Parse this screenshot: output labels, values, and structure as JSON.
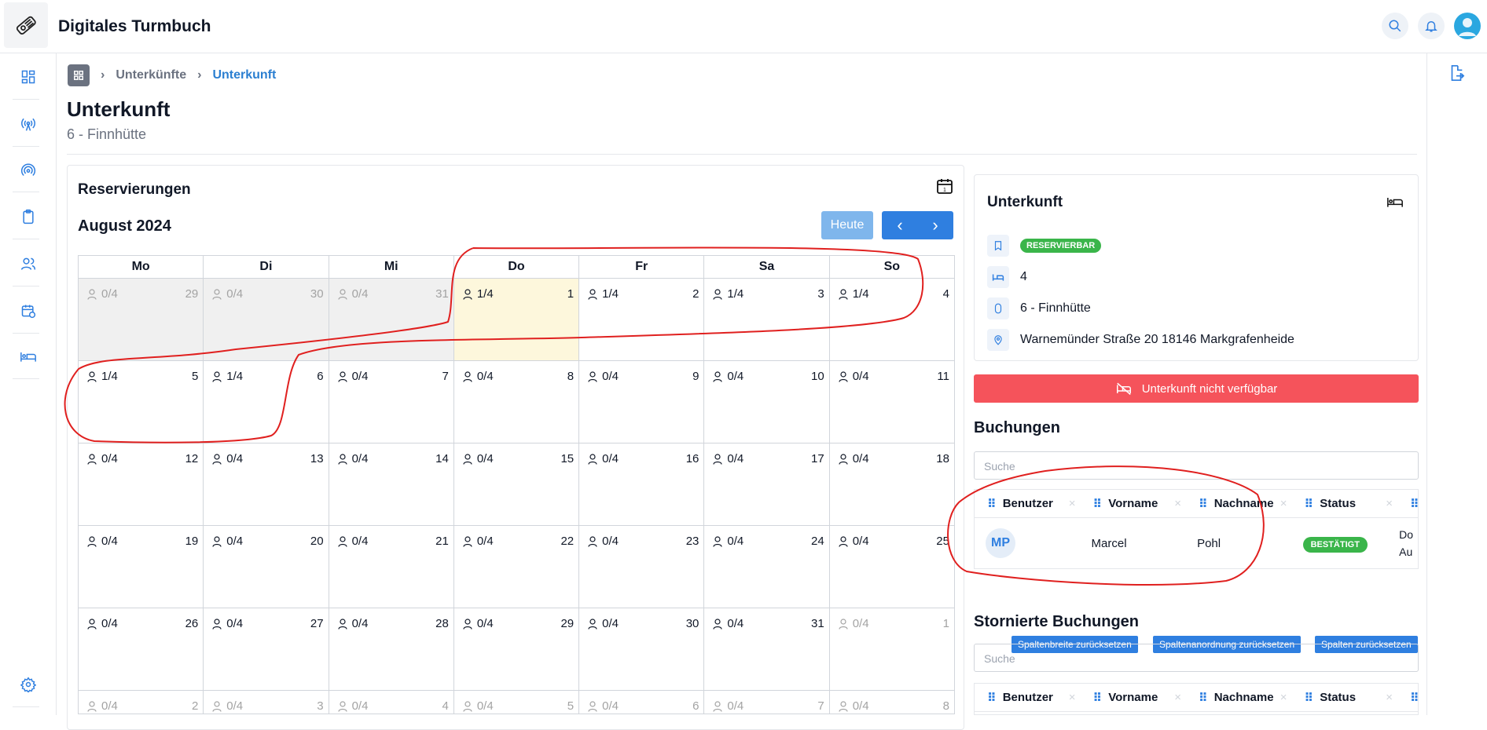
{
  "app": {
    "title": "Digitales Turmbuch"
  },
  "breadcrumb": {
    "items": [
      "Unterkünfte",
      "Unterkunft"
    ]
  },
  "page": {
    "title": "Unterkunft",
    "subtitle": "6 - Finnhütte"
  },
  "calendar": {
    "title": "Reservierungen",
    "month": "August 2024",
    "today_label": "Heute",
    "weekdays": [
      "Mo",
      "Di",
      "Mi",
      "Do",
      "Fr",
      "Sa",
      "So"
    ],
    "weeks": [
      [
        {
          "d": "29",
          "o": "0/4",
          "other": true
        },
        {
          "d": "30",
          "o": "0/4",
          "other": true
        },
        {
          "d": "31",
          "o": "0/4",
          "other": true
        },
        {
          "d": "1",
          "o": "1/4",
          "today": true
        },
        {
          "d": "2",
          "o": "1/4"
        },
        {
          "d": "3",
          "o": "1/4"
        },
        {
          "d": "4",
          "o": "1/4"
        }
      ],
      [
        {
          "d": "5",
          "o": "1/4"
        },
        {
          "d": "6",
          "o": "1/4"
        },
        {
          "d": "7",
          "o": "0/4"
        },
        {
          "d": "8",
          "o": "0/4"
        },
        {
          "d": "9",
          "o": "0/4"
        },
        {
          "d": "10",
          "o": "0/4"
        },
        {
          "d": "11",
          "o": "0/4"
        }
      ],
      [
        {
          "d": "12",
          "o": "0/4"
        },
        {
          "d": "13",
          "o": "0/4"
        },
        {
          "d": "14",
          "o": "0/4"
        },
        {
          "d": "15",
          "o": "0/4"
        },
        {
          "d": "16",
          "o": "0/4"
        },
        {
          "d": "17",
          "o": "0/4"
        },
        {
          "d": "18",
          "o": "0/4"
        }
      ],
      [
        {
          "d": "19",
          "o": "0/4"
        },
        {
          "d": "20",
          "o": "0/4"
        },
        {
          "d": "21",
          "o": "0/4"
        },
        {
          "d": "22",
          "o": "0/4"
        },
        {
          "d": "23",
          "o": "0/4"
        },
        {
          "d": "24",
          "o": "0/4"
        },
        {
          "d": "25",
          "o": "0/4"
        }
      ],
      [
        {
          "d": "26",
          "o": "0/4"
        },
        {
          "d": "27",
          "o": "0/4"
        },
        {
          "d": "28",
          "o": "0/4"
        },
        {
          "d": "29",
          "o": "0/4"
        },
        {
          "d": "30",
          "o": "0/4"
        },
        {
          "d": "31",
          "o": "0/4"
        },
        {
          "d": "1",
          "o": "0/4",
          "next": true
        }
      ],
      [
        {
          "d": "2",
          "o": "0/4",
          "next": true
        },
        {
          "d": "3",
          "o": "0/4",
          "next": true
        },
        {
          "d": "4",
          "o": "0/4",
          "next": true
        },
        {
          "d": "5",
          "o": "0/4",
          "next": true
        },
        {
          "d": "6",
          "o": "0/4",
          "next": true
        },
        {
          "d": "7",
          "o": "0/4",
          "next": true
        },
        {
          "d": "8",
          "o": "0/4",
          "next": true
        }
      ]
    ]
  },
  "info": {
    "title": "Unterkunft",
    "status_badge": "RESERVIERBAR",
    "beds": "4",
    "name": "6 - Finnhütte",
    "address": "Warnemünder Straße 20 18146 Markgrafenheide",
    "unavailable_button": "Unterkunft nicht verfügbar"
  },
  "bookings": {
    "title": "Buchungen",
    "search_placeholder": "Suche",
    "columns": [
      "Benutzer",
      "Vorname",
      "Nachname",
      "Status"
    ],
    "rows": [
      {
        "initials": "MP",
        "first": "Marcel",
        "last": "Pohl",
        "status": "BESTÄTIGT",
        "extra": "Do\nAu"
      }
    ],
    "reset_width": "Spaltenbreite zurücksetzen",
    "reset_order": "Spaltenanordnung zurücksetzen",
    "reset_columns": "Spalten zurücksetzen"
  },
  "cancelled": {
    "title": "Stornierte Buchungen",
    "search_placeholder": "Suche",
    "columns": [
      "Benutzer",
      "Vorname",
      "Nachname",
      "Status"
    ]
  },
  "colors": {
    "primary": "#2f7fe0",
    "danger": "#f5535b",
    "success": "#3ab54a",
    "today": "#fdf7dc"
  }
}
